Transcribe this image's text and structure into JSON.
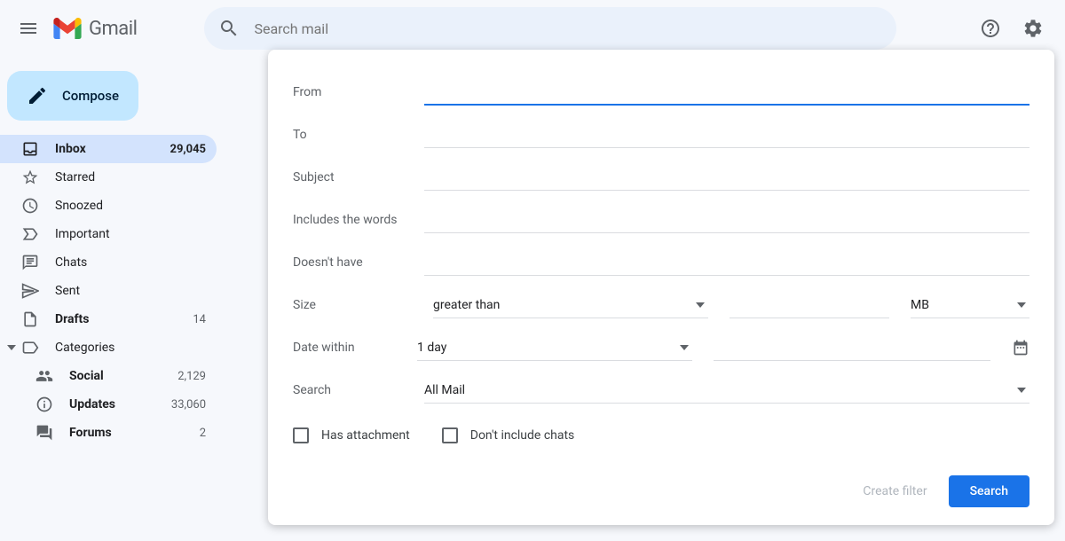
{
  "header": {
    "brand": "Gmail",
    "search_placeholder": "Search mail"
  },
  "compose_label": "Compose",
  "sidebar": {
    "items": [
      {
        "label": "Inbox",
        "count": "29,045"
      },
      {
        "label": "Starred",
        "count": ""
      },
      {
        "label": "Snoozed",
        "count": ""
      },
      {
        "label": "Important",
        "count": ""
      },
      {
        "label": "Chats",
        "count": ""
      },
      {
        "label": "Sent",
        "count": ""
      },
      {
        "label": "Drafts",
        "count": "14"
      },
      {
        "label": "Categories",
        "count": ""
      }
    ],
    "categories": [
      {
        "label": "Social",
        "count": "2,129"
      },
      {
        "label": "Updates",
        "count": "33,060"
      },
      {
        "label": "Forums",
        "count": "2"
      }
    ]
  },
  "panel": {
    "from_label": "From",
    "to_label": "To",
    "subject_label": "Subject",
    "includes_label": "Includes the words",
    "doesnt_label": "Doesn't have",
    "size_label": "Size",
    "size_op": "greater than",
    "size_unit": "MB",
    "date_label": "Date within",
    "date_range": "1 day",
    "search_label": "Search",
    "search_value": "All Mail",
    "has_attachment": "Has attachment",
    "no_chats": "Don't include chats",
    "create_filter": "Create filter",
    "search_btn": "Search"
  }
}
